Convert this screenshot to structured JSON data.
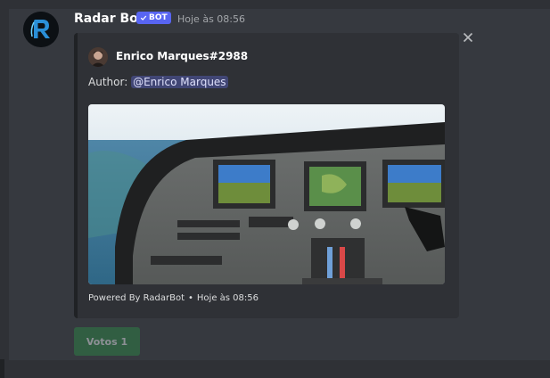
{
  "message": {
    "username": "Radar Bot",
    "bot_tag": "BOT",
    "timestamp": "Hoje às 08:56"
  },
  "embed": {
    "author": "Enrico Marques#2988",
    "description_label": "Author:",
    "mention": "@Enrico Marques",
    "footer_text": "Powered By RadarBot",
    "footer_separator": "•",
    "footer_time": "Hoje às 08:56",
    "close_icon": "close-icon",
    "image_description_icon": "cockpit-image"
  },
  "buttons": {
    "votes_label": "Votos 1"
  },
  "colors": {
    "bot_tag": "#5865f2",
    "vote_button": "#2d7d46",
    "mention_bg": "#414675"
  }
}
